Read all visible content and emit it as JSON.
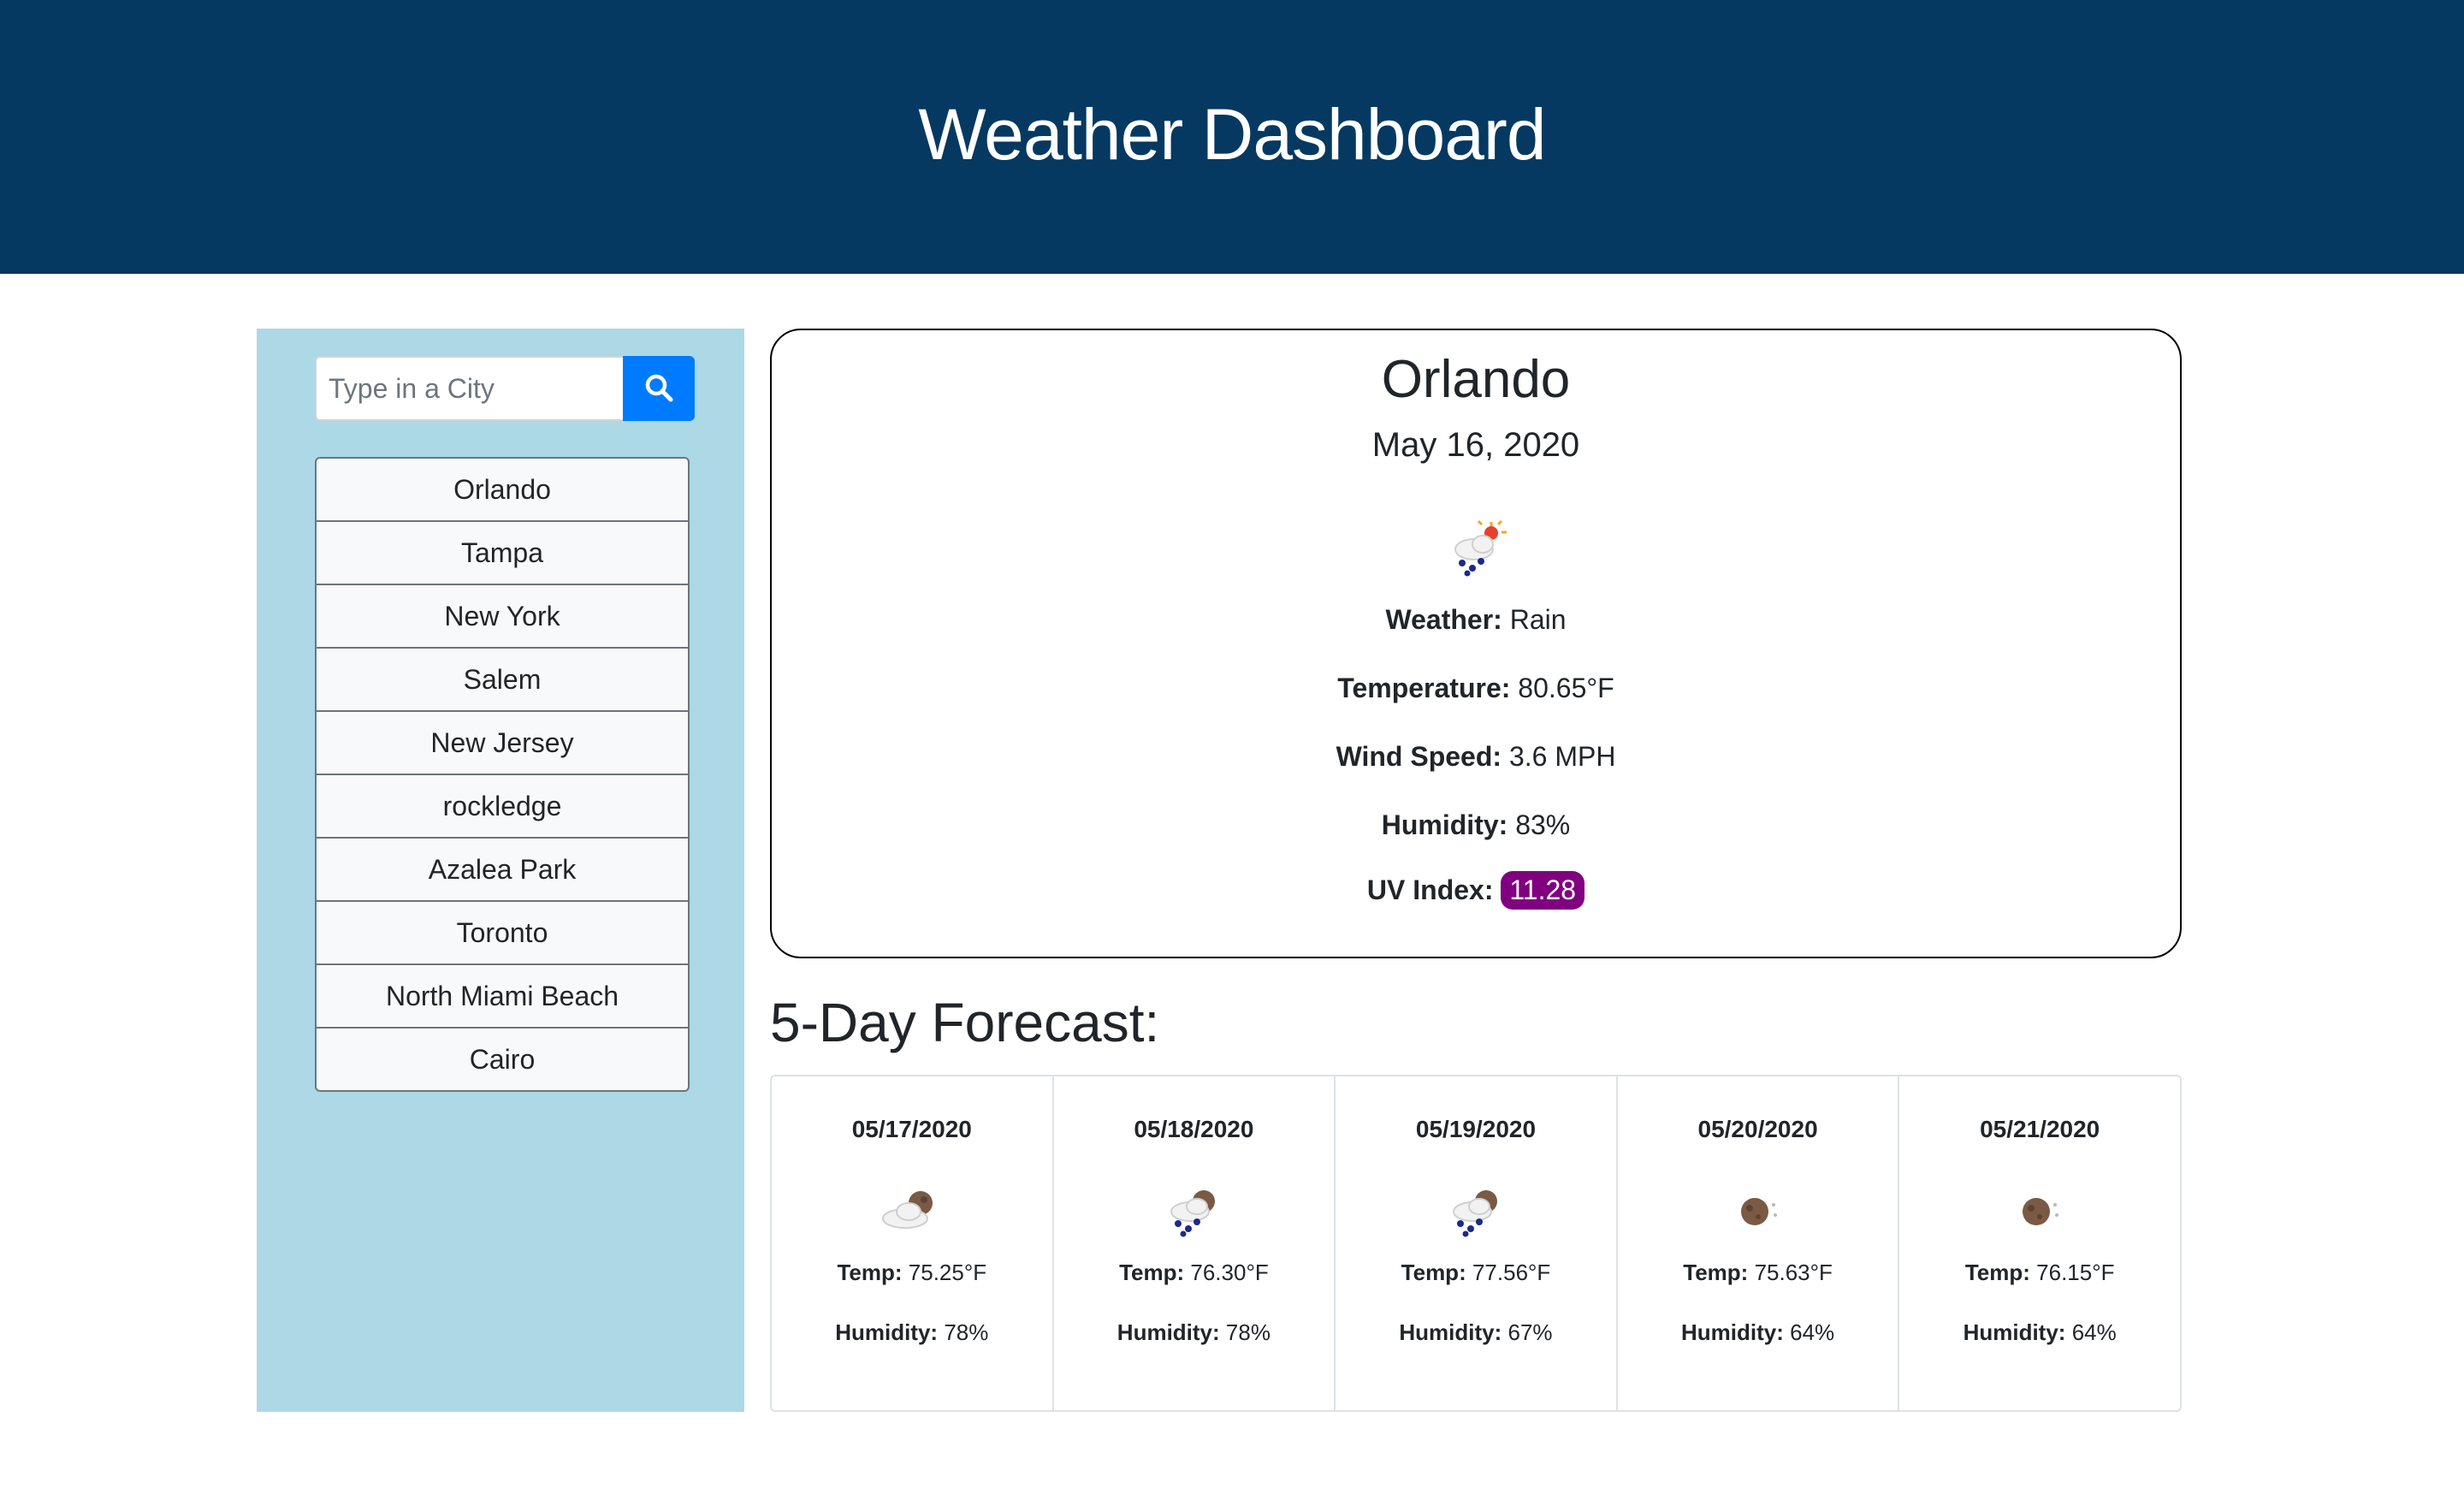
{
  "header": {
    "title": "Weather Dashboard"
  },
  "search": {
    "placeholder": "Type in a City",
    "icon": "search-icon"
  },
  "sidebar": {
    "cities": [
      "Orlando",
      "Tampa",
      "New York",
      "Salem",
      "New Jersey",
      "rockledge",
      "Azalea Park",
      "Toronto",
      "North Miami Beach",
      "Cairo"
    ]
  },
  "current": {
    "city": "Orlando",
    "date": "May 16, 2020",
    "icon": "rain-sun-icon",
    "weather_label": "Weather:",
    "weather_value": "Rain",
    "temp_label": "Temperature:",
    "temp_value": "80.65°F",
    "wind_label": "Wind Speed:",
    "wind_value": "3.6 MPH",
    "humidity_label": "Humidity:",
    "humidity_value": "83%",
    "uv_label": "UV Index:",
    "uv_value": "11.28",
    "uv_color": "#800080"
  },
  "forecast": {
    "title": "5-Day Forecast:",
    "temp_label": "Temp:",
    "humidity_label": "Humidity:",
    "days": [
      {
        "date": "05/17/2020",
        "icon": "cloud-night-icon",
        "temp": "75.25°F",
        "humidity": "78%"
      },
      {
        "date": "05/18/2020",
        "icon": "rain-night-icon",
        "temp": "76.30°F",
        "humidity": "78%"
      },
      {
        "date": "05/19/2020",
        "icon": "rain-night-icon",
        "temp": "77.56°F",
        "humidity": "67%"
      },
      {
        "date": "05/20/2020",
        "icon": "clear-night-icon",
        "temp": "75.63°F",
        "humidity": "64%"
      },
      {
        "date": "05/21/2020",
        "icon": "clear-night-icon",
        "temp": "76.15°F",
        "humidity": "64%"
      }
    ]
  },
  "colors": {
    "header_bg": "#053961",
    "sidebar_bg": "#add8e6",
    "search_button": "#007bff"
  }
}
